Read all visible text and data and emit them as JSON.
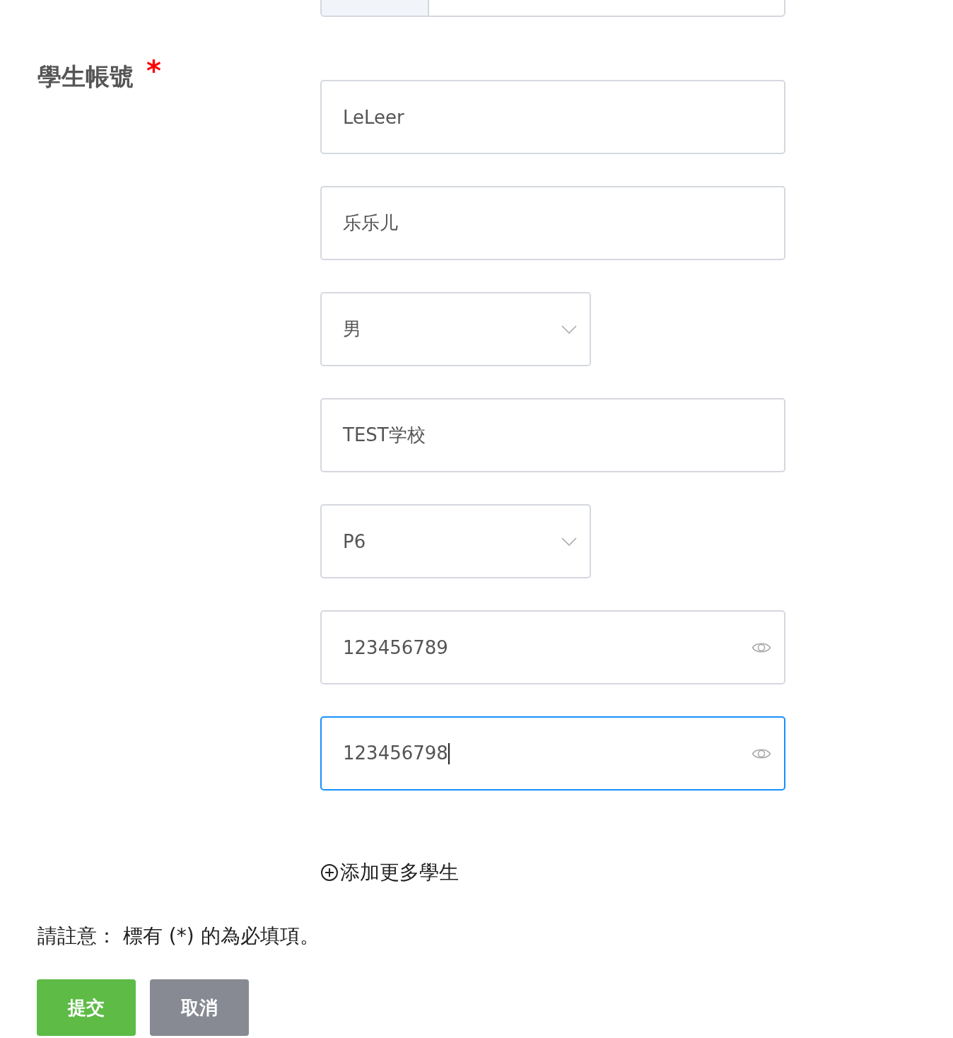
{
  "label": "學生帳號",
  "required_mark": "*",
  "fields": [
    {
      "kind": "text",
      "value": "LeLeer",
      "focused": false
    },
    {
      "kind": "text",
      "value": "乐乐儿",
      "focused": false
    },
    {
      "kind": "select",
      "value": "男",
      "focused": false
    },
    {
      "kind": "text",
      "value": "TEST学校",
      "focused": false
    },
    {
      "kind": "select",
      "value": "P6",
      "focused": false
    },
    {
      "kind": "password",
      "value": "123456789",
      "focused": false
    },
    {
      "kind": "password",
      "value": "123456798",
      "focused": true
    }
  ],
  "add_link": "添加更多學生",
  "note": "請註意： 標有 (*) 的為必填項。",
  "buttons": [
    {
      "kind": "primary",
      "label": "提交"
    },
    {
      "kind": "secondary",
      "label": "取消"
    }
  ]
}
